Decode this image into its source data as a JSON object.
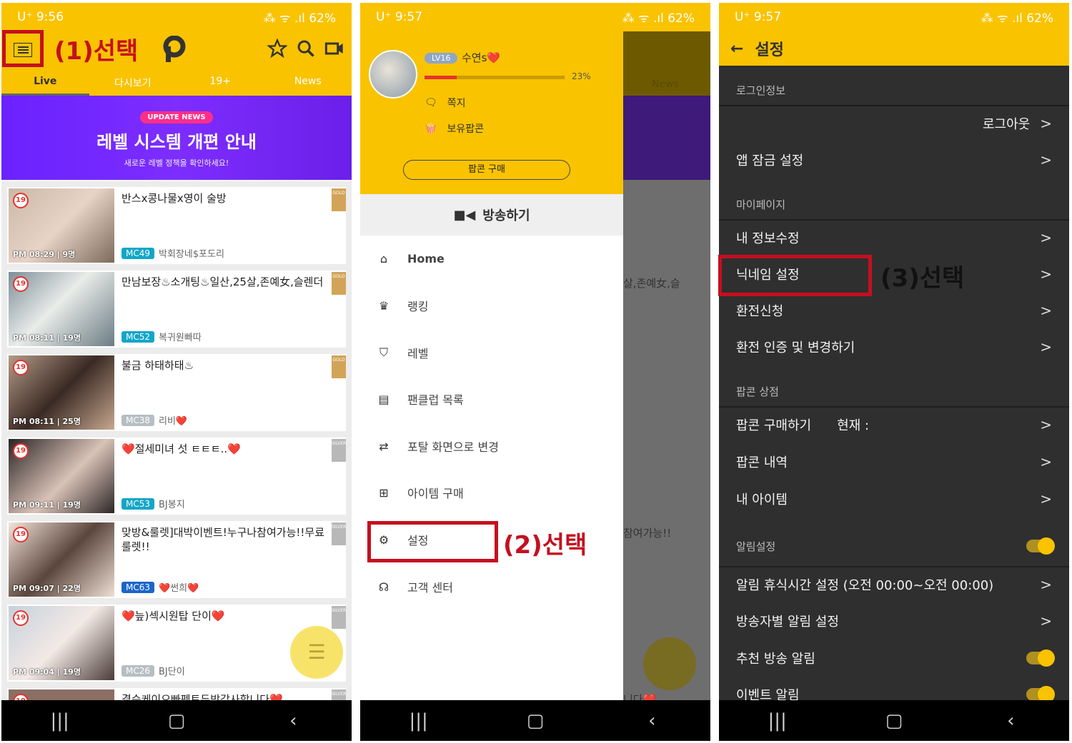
{
  "status": {
    "carrier": "U⁺",
    "battery": "62%",
    "signal": "⁂ ᯤ .ıl",
    "time1": "9:56",
    "time2": "9:57",
    "time3": "9:57"
  },
  "screen1": {
    "tabs": [
      "Live",
      "다시보기",
      "19+",
      "News"
    ],
    "banner": {
      "badge": "UPDATE NEWS",
      "title_a": "레벨 시스템",
      "title_b": "개편 안내",
      "subtitle": "새로운 레벨 정책을 확인하세요!"
    },
    "streams": [
      {
        "title": "반스x콩나물x영이 술방",
        "time": "PM 08:29 | 9명",
        "mc": "MC49",
        "bj": "박회장네$포도리",
        "grade": "GOLD",
        "age": "19"
      },
      {
        "title": "만남보장♨소개팅♨일산,25살,존예女,슬렌더",
        "time": "PM 08:11 | 19명",
        "mc": "MC52",
        "bj": "복귀원빠따",
        "grade": "GOLD",
        "age": "19"
      },
      {
        "title": "불금 하태하태♨",
        "time": "PM 08:11 | 25명",
        "mc": "MC38",
        "bj": "리비❤️",
        "grade": "GOLD",
        "age": "19"
      },
      {
        "title": "❤️절세미녀 섯 ㅌㅌㅌ..❤️",
        "time": "PM 09:11 | 19명",
        "mc": "MC53",
        "bj": "BJ봉지",
        "grade": "SILVER",
        "age": "19"
      },
      {
        "title": "맞방&룰렛]대박이벤트!누구나참여가능!!무료룰렛!!",
        "time": "PM 09:07 | 22명",
        "mc": "MC63",
        "bj": "❤️썬희❤️",
        "grade": "SILVER",
        "age": "19"
      },
      {
        "title": "❤️늪)섹시원탑 단이❤️",
        "time": "PM 09:04 | 19명",
        "mc": "MC26",
        "bj": "BJ단이",
        "grade": "SILVER",
        "age": "19"
      },
      {
        "title": "결승케이오빠펜트두방감사합니다❤️",
        "time": "",
        "mc": "",
        "bj": "",
        "grade": "SILVER",
        "age": "19"
      }
    ],
    "annotation": "(1)선택"
  },
  "screen2": {
    "level": "LV16",
    "username": "수연s❤️",
    "progress_pct": 23,
    "progress_label": "23%",
    "message_label": "쪽지",
    "popcorn_label": "보유팝콘",
    "buy_button": "팝콘 구매",
    "broadcast_button": "방송하기",
    "menu": [
      "Home",
      "랭킹",
      "레벨",
      "팬클럽 목록",
      "포탈 화면으로 변경",
      "아이템 구매",
      "설정",
      "고객 센터"
    ],
    "behind": {
      "tab": "News",
      "row2": "살,존예女,슬",
      "row5": "참여가능!!",
      "row7": "니다❤️"
    },
    "annotation": "(2)선택"
  },
  "screen3": {
    "title": "설정",
    "sections": {
      "login": "로그인정보",
      "mypage": "마이페이지",
      "shop": "팝콘 상점",
      "alarm": "알림설정"
    },
    "rows": {
      "logout": "로그아웃",
      "applock": "앱 잠금 설정",
      "editinfo": "내 정보수정",
      "nickname": "닉네임 설정",
      "exchange": "환전신청",
      "exchange_auth": "환전 인증 및 변경하기",
      "buy_popcorn": "팝콘 구매하기",
      "current": "현재 :",
      "popcorn_history": "팝콘 내역",
      "my_items": "내 아이템",
      "quiet_time": "알림 휴식시간 설정 (오전 00:00~오전 00:00)",
      "per_bj": "방송자별 알림 설정",
      "recommend": "추천 방송 알림",
      "event": "이벤트 알림"
    },
    "chevron": ">",
    "annotation": "(3)선택"
  },
  "colors": {
    "brand_yellow": "#f9c300",
    "annotation_red": "#c50f1f",
    "settings_bg": "#2f2f2f"
  }
}
